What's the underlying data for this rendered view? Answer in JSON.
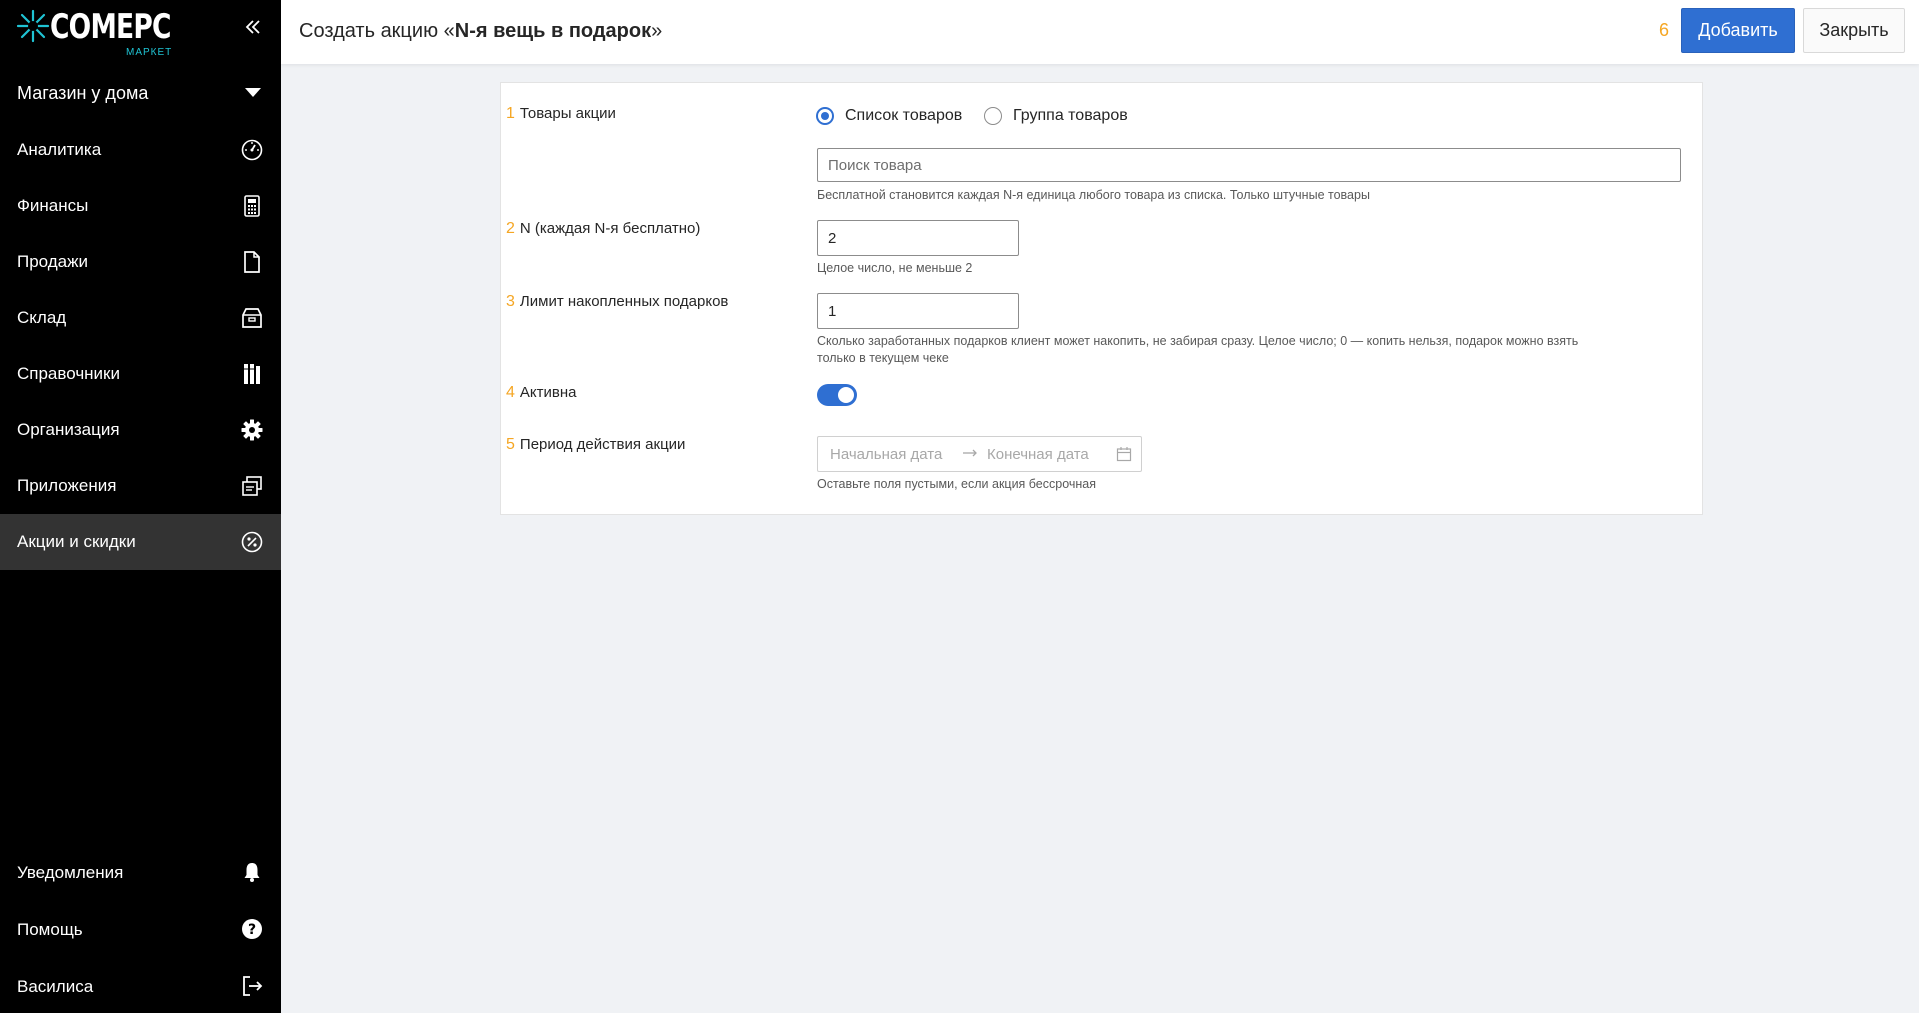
{
  "app": {
    "logo_text": "COMEPC",
    "logo_sub": "МАРКЕТ"
  },
  "sidebar": {
    "store": "Магазин у дома",
    "items": [
      {
        "label": "Аналитика",
        "icon": "dashboard-icon"
      },
      {
        "label": "Финансы",
        "icon": "calculator-icon"
      },
      {
        "label": "Продажи",
        "icon": "document-icon"
      },
      {
        "label": "Склад",
        "icon": "warehouse-box-icon"
      },
      {
        "label": "Справочники",
        "icon": "books-icon"
      },
      {
        "label": "Организация",
        "icon": "gear-icon"
      },
      {
        "label": "Приложения",
        "icon": "apps-windows-icon"
      },
      {
        "label": "Акции и скидки",
        "icon": "percent-icon",
        "active": true
      }
    ],
    "bottom": [
      {
        "label": "Уведомления",
        "icon": "bell-icon"
      },
      {
        "label": "Помощь",
        "icon": "help-icon"
      },
      {
        "label": "Василиса",
        "icon": "logout-icon"
      }
    ]
  },
  "header": {
    "title_prefix": "Создать акцию «",
    "title_bold": "N-я вещь в подарок",
    "title_suffix": "»",
    "step": "6",
    "add_label": "Добавить",
    "close_label": "Закрыть"
  },
  "form": {
    "products": {
      "step": "1",
      "label": "Товары акции",
      "option_list": "Список товаров",
      "option_group": "Группа товаров",
      "selected": "Список товаров",
      "search_placeholder": "Поиск товара",
      "hint": "Бесплатной становится каждая N-я единица любого товара из списка. Только штучные товары"
    },
    "n": {
      "step": "2",
      "label": "N (каждая N-я бесплатно)",
      "value": "2",
      "hint": "Целое число, не меньше 2"
    },
    "limit": {
      "step": "3",
      "label": "Лимит накопленных подарков",
      "value": "1",
      "hint_line1": "Сколько заработанных подарков клиент может накопить, не забирая сразу. Целое число; 0 — копить нельзя, подарок можно взять",
      "hint_line2": "только в текущем чеке"
    },
    "active": {
      "step": "4",
      "label": "Активна",
      "value": true
    },
    "period": {
      "step": "5",
      "label": "Период действия акции",
      "start_placeholder": "Начальная дата",
      "end_placeholder": "Конечная дата",
      "hint": "Оставьте поля пустыми, если акция бессрочная"
    }
  },
  "colors": {
    "primary": "#2f6fd2",
    "step_number": "#f5a623",
    "sidebar_bg": "#000000",
    "sidebar_active": "#333333",
    "logo_accent": "#1fc4d4"
  }
}
